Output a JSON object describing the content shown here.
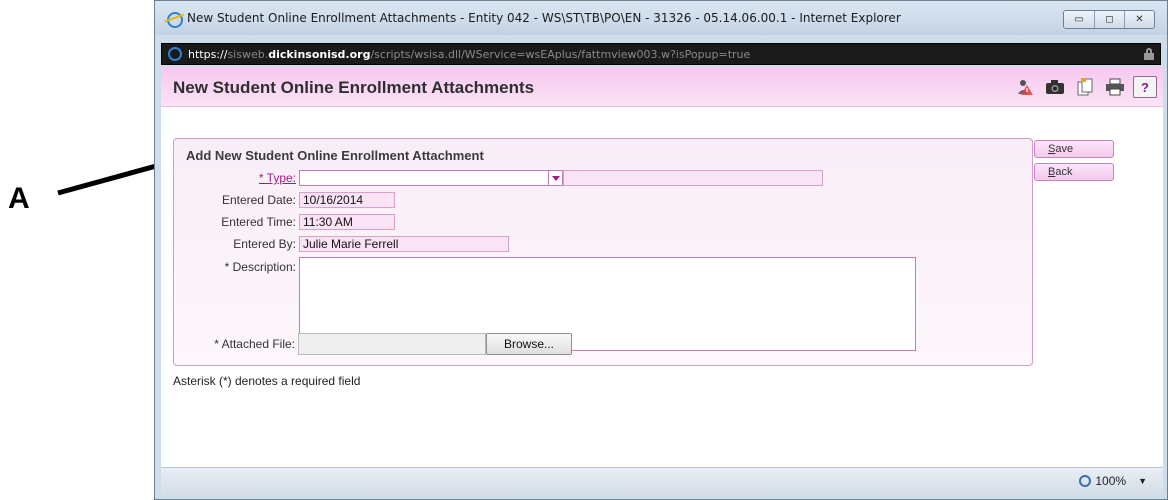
{
  "annotation": {
    "letter": "A"
  },
  "window": {
    "title": "New Student Online Enrollment Attachments - Entity 042 - WS\\ST\\TB\\PO\\EN - 31326 - 05.14.06.00.1 - Internet Explorer",
    "url_scheme": "https://",
    "url_pre_domain": "sisweb.",
    "url_domain": "dickinsonisd.org",
    "url_path": "/scripts/wsisa.dll/WService=wsEAplus/fattmview003.w?isPopup=true"
  },
  "header": {
    "title": "New Student Online Enrollment Attachments",
    "icons": [
      "person-alert-icon",
      "camera-icon",
      "page-copy-icon",
      "printer-icon",
      "help-icon"
    ],
    "help_label": "?"
  },
  "form": {
    "section_title": "Add New Student Online Enrollment Attachment",
    "type_label": "* Type:",
    "type_value": "",
    "entered_date_label": "Entered Date:",
    "entered_date_value": "10/16/2014",
    "entered_time_label": "Entered Time:",
    "entered_time_value": "11:30 AM",
    "entered_by_label": "Entered By:",
    "entered_by_value": "Julie Marie Ferrell",
    "description_label": "* Description:",
    "description_value": "",
    "attached_file_label": "* Attached File:",
    "browse_label": "Browse..."
  },
  "actions": {
    "save_first": "S",
    "save_rest": "ave",
    "back_first": "B",
    "back_rest": "ack"
  },
  "footer_note": "Asterisk (*) denotes a required field",
  "status": {
    "zoom": "100%"
  },
  "colors": {
    "header_pink": "#f6c8ef",
    "field_pink": "#fbe3f6",
    "link_purple": "#9b1d8a",
    "annotation_blue": "#2a4a7a"
  }
}
